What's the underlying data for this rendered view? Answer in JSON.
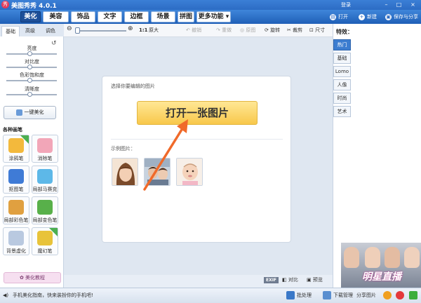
{
  "app": {
    "logo_glyph": "秀",
    "title": "美图秀秀 4.0.1",
    "login": "登录"
  },
  "window_controls": {
    "minimize": "–",
    "maximize": "□",
    "close": "×"
  },
  "menu": {
    "tabs": [
      "美化",
      "美容",
      "饰品",
      "文字",
      "边框",
      "场景",
      "拼图",
      "更多功能 ▾"
    ],
    "active_tab": "美化",
    "actions": {
      "open": "打开",
      "new": "新建",
      "save_share": "保存与分享"
    }
  },
  "toolbar": {
    "zoom_out": "⊖",
    "zoom_in": "⊕",
    "ratio": "1:1",
    "original_size": "原大",
    "undo": "撤销",
    "redo": "重做",
    "original_image": "原图",
    "rotate": "旋转",
    "crop": "裁剪",
    "size": "尺寸"
  },
  "left_panel": {
    "tabs": [
      "基础",
      "高级",
      "调色"
    ],
    "active_tab": "基础",
    "reset_glyph": "↺",
    "adjustments": [
      "亮度",
      "对比度",
      "色彩饱和度",
      "清晰度"
    ],
    "one_click": "一键美化",
    "section_title": "各种画笔",
    "pens": [
      {
        "label": "涂鸦笔",
        "new": true,
        "color": "#f3b93c"
      },
      {
        "label": "消除笔",
        "new": false,
        "color": "#f2a6b8"
      },
      {
        "label": "抠图笔",
        "new": false,
        "color": "#3f7bd6"
      },
      {
        "label": "局部马赛克",
        "new": false,
        "color": "#5db8e8"
      },
      {
        "label": "局部彩色笔",
        "new": false,
        "color": "#e0a040"
      },
      {
        "label": "局部变色笔",
        "new": false,
        "color": "#58b04a"
      },
      {
        "label": "背景虚化",
        "new": false,
        "color": "#b9c9e0"
      },
      {
        "label": "魔幻笔",
        "new": true,
        "color": "#e8c33a"
      }
    ],
    "tutorial": "美化教程"
  },
  "canvas": {
    "card_title": "选择你要编辑的图片",
    "open_button": "打开一张图片",
    "sample_label": "示例图片：",
    "arrow_color": "#f06a2a"
  },
  "bottom_bar": {
    "exif": "EXIF",
    "compare": "对比",
    "preview": "预览"
  },
  "right_panel": {
    "title": "特效：",
    "tabs": [
      "热门",
      "基础",
      "Lomo",
      "人像",
      "时尚",
      "艺术"
    ],
    "active_tab": "热门",
    "banner_text": "明星直播"
  },
  "status_bar": {
    "tip": "手机美化指南，快来装扮你的手机吧!",
    "batch": "批处理",
    "download": "下载管理",
    "share": "分享图片"
  }
}
